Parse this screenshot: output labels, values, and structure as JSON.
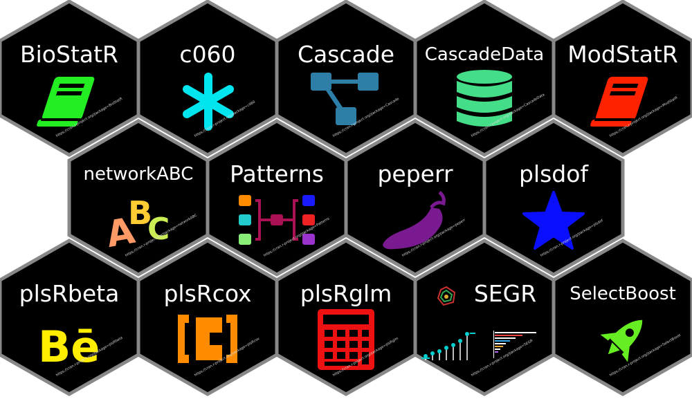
{
  "packages": [
    {
      "name": "BioStatR",
      "url": "https://cran.r-project.org/package=BioStatR",
      "icon": "book-icon",
      "color": "#22ee22"
    },
    {
      "name": "c060",
      "url": "https://cran.r-project.org/package=c060",
      "icon": "asterisk-icon",
      "color": "#00e5ee"
    },
    {
      "name": "Cascade",
      "url": "https://cran.r-project.org/package=Cascade",
      "icon": "flow-diagram-icon",
      "color": "#2d7fa8"
    },
    {
      "name": "CascadeData",
      "url": "https://cran.r-project.org/package=CascadeData",
      "icon": "database-icon",
      "color": "#44dd88"
    },
    {
      "name": "ModStatR",
      "url": "https://cran.r-project.org/package=ModStatR",
      "icon": "book-icon",
      "color": "#ff2200"
    },
    {
      "name": "networkABC",
      "url": "https://cran.r-project.org/package=networkABC",
      "icon": "abc-letters-icon",
      "color": "#f0a830"
    },
    {
      "name": "Patterns",
      "url": "https://cran.r-project.org/package=Patterns",
      "icon": "pattern-network-icon",
      "color": "#aa1155"
    },
    {
      "name": "peperr",
      "url": "https://cran.r-project.org/package=peperr",
      "icon": "pepper-icon",
      "color": "#7a1a90"
    },
    {
      "name": "plsdof",
      "url": "https://cran.r-project.org/package=plsdof",
      "icon": "star-icon",
      "color": "#0a10ff"
    },
    {
      "name": "plsRbeta",
      "url": "https://cran.r-project.org/package=plsRbeta",
      "icon": "behance-icon",
      "color": "#ffee00"
    },
    {
      "name": "plsRcox",
      "url": "https://cran.r-project.org/package=plsRcox",
      "icon": "codepen-bracket-icon",
      "color": "#ff8c00"
    },
    {
      "name": "plsRglm",
      "url": "https://cran.r-project.org/package=plsRglm",
      "icon": "calculator-icon",
      "color": "#ee1111"
    },
    {
      "name": "SEGR",
      "url": "https://cran.r-project.org/package=SEGR",
      "icon": "plots-icon",
      "color": "#00d0d0"
    },
    {
      "name": "SelectBoost",
      "url": "https://cran.r-project.org/package=SelectBoost",
      "icon": "rocket-icon",
      "color": "#66ee22"
    }
  ]
}
